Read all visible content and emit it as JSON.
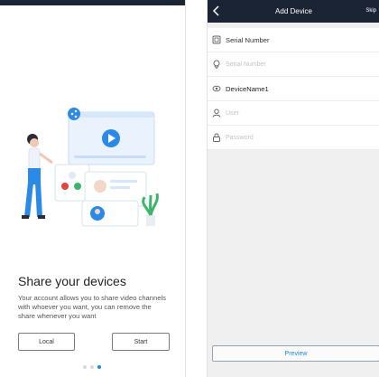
{
  "onboarding": {
    "title": "Share your devices",
    "description": "Your account allows you to share video channels with whoever you want, you can remove the share whenever you want",
    "local_label": "Local",
    "start_label": "Start",
    "page_dots": 3,
    "active_dot": 2
  },
  "add_device": {
    "title": "Add Device",
    "skip_label": "Skip",
    "rows": [
      {
        "icon": "serial-icon",
        "text": "Serial Number",
        "kind": "label"
      },
      {
        "icon": "location-pin-icon",
        "text": "Serial Number",
        "kind": "placeholder"
      },
      {
        "icon": "eye-icon",
        "text": "DeviceName1",
        "kind": "value"
      },
      {
        "icon": "user-icon",
        "text": "User",
        "kind": "placeholder"
      },
      {
        "icon": "lock-icon",
        "text": "Password",
        "kind": "placeholder"
      }
    ],
    "preview_label": "Preview"
  },
  "colors": {
    "header_bg": "#1b2434",
    "accent": "#1e88e5",
    "form_bg": "#ffffff",
    "page_bg": "#f0f0f0"
  }
}
